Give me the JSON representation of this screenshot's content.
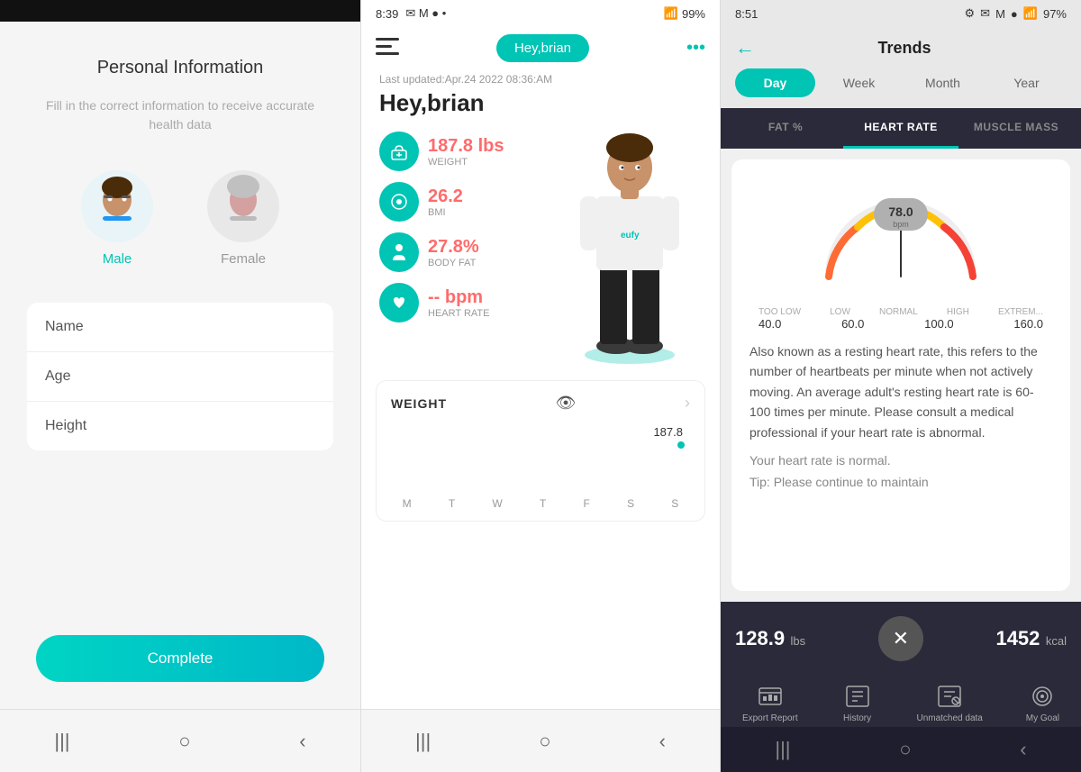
{
  "panel1": {
    "title": "Personal Information",
    "subtitle": "Fill in the correct information to receive accurate health data",
    "genders": [
      {
        "id": "male",
        "label": "Male",
        "active": true
      },
      {
        "id": "female",
        "label": "Female",
        "active": false
      }
    ],
    "fields": [
      {
        "id": "name",
        "label": "Name"
      },
      {
        "id": "age",
        "label": "Age"
      },
      {
        "id": "height",
        "label": "Height"
      }
    ],
    "complete_btn": "Complete",
    "nav": [
      "|||",
      "○",
      "<"
    ]
  },
  "panel2": {
    "status": {
      "time": "8:39",
      "icons": "✉ M ● •",
      "battery": "99%"
    },
    "greeting": "Hey,brian",
    "last_updated": "Last updated:Apr.24 2022 08:36:AM",
    "metrics": [
      {
        "value": "187.8 lbs",
        "label": "WEIGHT",
        "icon": "⚖"
      },
      {
        "value": "26.2",
        "label": "BMI",
        "icon": "●"
      },
      {
        "value": "27.8%",
        "label": "Body Fat",
        "icon": "👤"
      },
      {
        "value": "-- bpm",
        "label": "Heart Rate",
        "icon": "♥"
      }
    ],
    "weight_section": {
      "title": "WEIGHT",
      "value": "187.8",
      "days": [
        "M",
        "T",
        "W",
        "T",
        "F",
        "S",
        "S"
      ]
    },
    "nav": [
      "|||",
      "○",
      "<"
    ]
  },
  "panel3": {
    "status": {
      "time": "8:51",
      "icons": "✦ ✉ M ●",
      "battery": "97%"
    },
    "title": "Trends",
    "time_tabs": [
      {
        "label": "Day",
        "active": true
      },
      {
        "label": "Week",
        "active": false
      },
      {
        "label": "Month",
        "active": false
      },
      {
        "label": "Year",
        "active": false
      }
    ],
    "metric_tabs": [
      {
        "label": "FAT %",
        "active": false
      },
      {
        "label": "HEART RATE",
        "active": true
      },
      {
        "label": "MUSCLE MASS",
        "active": false
      }
    ],
    "heart_rate": {
      "bpm": "78.0",
      "unit": "bpm",
      "range_labels": [
        "TOO LOW",
        "LOW",
        "NORMAL",
        "HIGH",
        "EXTREM..."
      ],
      "range_values": [
        "40.0",
        "60.0",
        "100.0",
        "160.0"
      ],
      "description": "Also known as a resting heart rate, this refers to the number of heartbeats per minute when not actively moving. An average adult's resting heart rate is 60-100 times per minute. Please consult a medical professional if your heart rate is abnormal.",
      "status": "Your heart rate is normal.",
      "tip": "Tip: Please continue to maintain"
    },
    "bottom_stats": {
      "weight": "128.9",
      "weight_unit": "lbs",
      "calories": "1452",
      "calories_unit": "kcal"
    },
    "bottom_nav": [
      {
        "label": "Export Report",
        "icon": "📊"
      },
      {
        "label": "History",
        "icon": "📋"
      },
      {
        "label": "Unmatched data",
        "icon": "🔗"
      },
      {
        "label": "My Goal",
        "icon": "🎯"
      }
    ],
    "nav": [
      "|||",
      "○",
      "<"
    ]
  }
}
